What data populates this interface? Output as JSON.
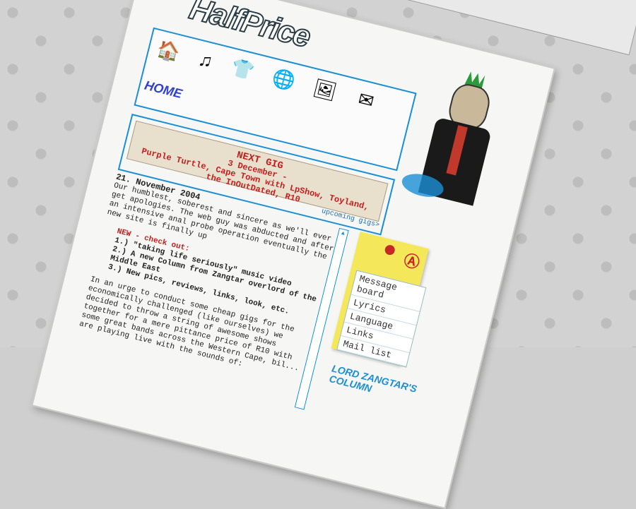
{
  "site": {
    "logo_text": "HalfPrice"
  },
  "nav": {
    "items": [
      {
        "icon": "home-icon",
        "glyph": "🏠"
      },
      {
        "icon": "music-icon",
        "glyph": "♫"
      },
      {
        "icon": "merch-icon",
        "glyph": "👕"
      },
      {
        "icon": "download-icon",
        "glyph": "🌐"
      },
      {
        "icon": "photos-icon",
        "glyph": "🖼"
      },
      {
        "icon": "contact-icon",
        "glyph": "✉"
      }
    ],
    "home_label": "HOME"
  },
  "gig": {
    "title": "NEXT GIG",
    "line1": "3 December -",
    "line2": "Purple Turtle, Cape Town with LpShow, Toyland,",
    "line3": "the InOutDated, R10",
    "upcoming_link": "upcoming gigs>"
  },
  "news": {
    "date": "21. November 2004",
    "body": "Our humblest, soberest and sincere as we'll ever get apologies. The web guy was abducted and after an intensive anal probe operation eventually the new site is finally up",
    "new_head": "NEW - check out:",
    "items": [
      "1.) \"taking life seriously\" music video",
      "2.) A new Column from Zangtar overlord of the Middle East",
      "3.) New pics, reviews, links, look, etc."
    ],
    "intro": "In an urge to conduct some cheap gigs for the economically challenged (like ourselves) we decided to throw a string of awesome shows together for a mere pittance price of R10 with some great bands across the Western Cape, bil... are playing live with the sounds of:"
  },
  "menu": {
    "items": [
      "Message board",
      "Lyrics",
      "Language",
      "Links",
      "Mail list"
    ]
  },
  "column_label": {
    "line1": "LORD ZANGTAR'S",
    "line2": "COLUMN"
  },
  "browser": {
    "go_icon": "go-arrow-icon"
  },
  "colors": {
    "accent": "#1a8fd6",
    "gig_red": "#c41f1f",
    "note_yellow": "#f5e75a"
  }
}
